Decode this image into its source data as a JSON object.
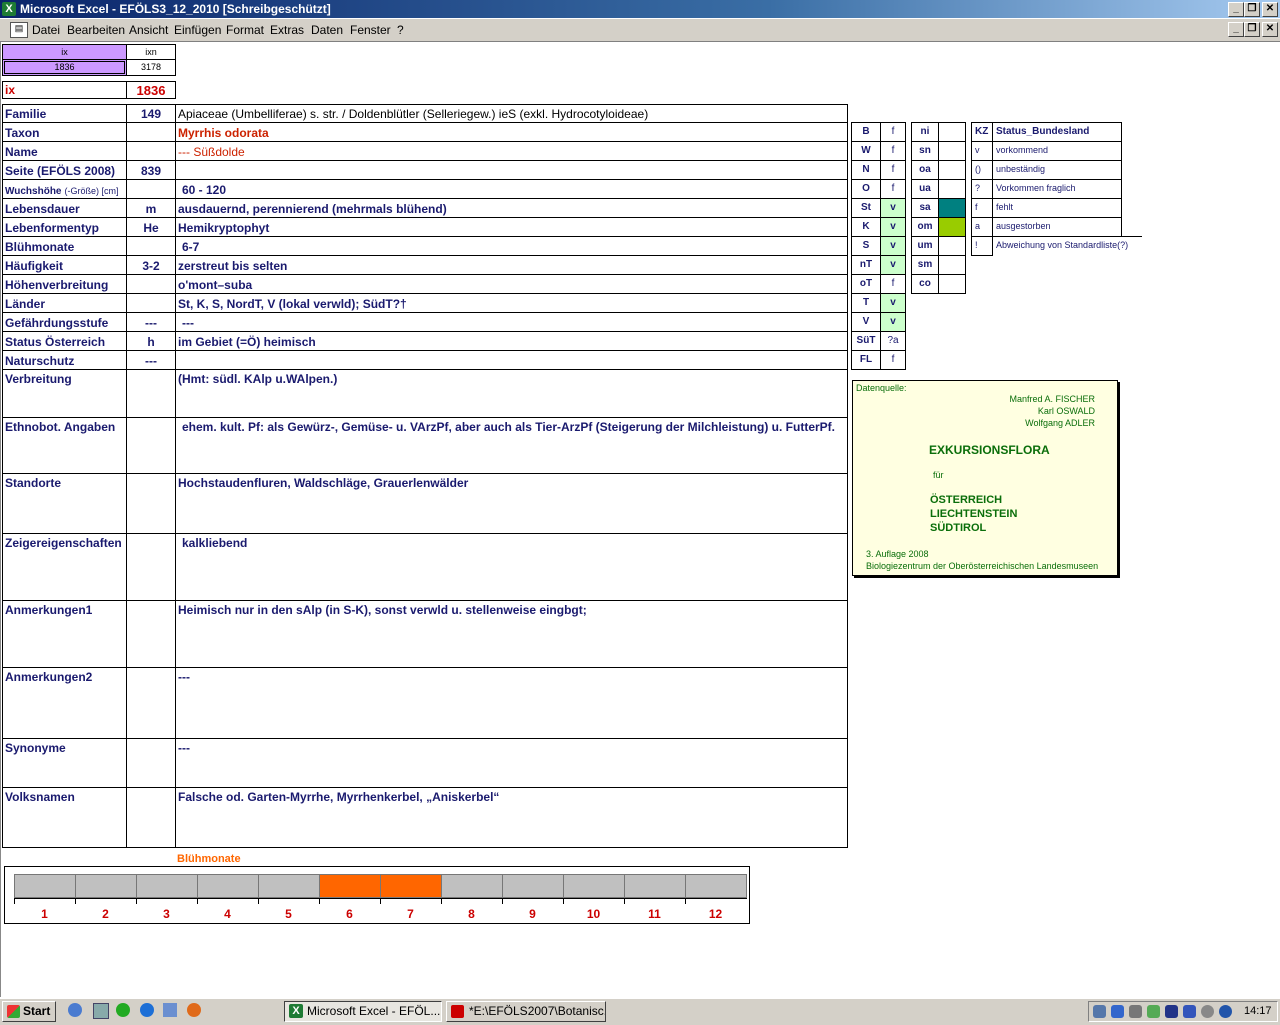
{
  "window": {
    "title": "Microsoft Excel - EFÖLS3_12_2010  [Schreibgeschützt]"
  },
  "menu": [
    "Datei",
    "Bearbeiten",
    "Ansicht",
    "Einfügen",
    "Format",
    "Extras",
    "Daten",
    "Fenster",
    "?"
  ],
  "top": {
    "ix_label": "ix",
    "ixn_label": "ixn",
    "ix_value": "1836",
    "ixn_value": "3178",
    "ix_big_label": "ix",
    "ix_big_value": "1836"
  },
  "rows": [
    {
      "label": "Familie",
      "code": "149",
      "value": "Apiaceae (Umbelliferae) s. str.  /  Doldenblütler (Selleriegew.) ieS (exkl. Hydrocotyloideae)"
    },
    {
      "label": "Taxon",
      "code": "",
      "value": "Myrrhis odorata"
    },
    {
      "label": "Name",
      "code": "",
      "value": "--- Süßdolde"
    },
    {
      "label": "Seite (EFÖLS 2008)",
      "code": "839",
      "value": ""
    },
    {
      "label": "Wuchshöhe",
      "label_suffix": "(-Größe) [cm]",
      "code": "",
      "value": "60 - 120"
    },
    {
      "label": "Lebensdauer",
      "code": "m",
      "value": "ausdauernd, perennierend (mehrmals blühend)"
    },
    {
      "label": "Lebenformentyp",
      "code": "He",
      "value": "Hemikryptophyt"
    },
    {
      "label": "Blühmonate",
      "code": "",
      "value": "6-7"
    },
    {
      "label": "Häufigkeit",
      "code": "3-2",
      "value": "zerstreut bis selten"
    },
    {
      "label": "Höhenverbreitung",
      "code": "",
      "value": "o'mont–suba"
    },
    {
      "label": "Länder",
      "code": "",
      "value": "St, K, S, NordT, V (lokal verwld); SüdT?†"
    },
    {
      "label": "Gefährdungsstufe",
      "code": "---",
      "value": "---"
    },
    {
      "label": "Status Österreich",
      "code": "h",
      "value": "im Gebiet (=Ö) heimisch"
    },
    {
      "label": "Naturschutz",
      "code": "---",
      "value": ""
    },
    {
      "label": "Verbreitung",
      "code": "",
      "value": "(Hmt: südl. KAlp u.WAlpen.)"
    },
    {
      "label": "Ethnobot. Angaben",
      "code": "",
      "value": "ehem. kult. Pf: als Gewürz-, Gemüse- u. VArzPf, aber auch als Tier-ArzPf (Steigerung der Milchleistung) u. FutterPf."
    },
    {
      "label": "Standorte",
      "code": "",
      "value": "Hochstaudenfluren, Waldschläge, Grauerlenwälder"
    },
    {
      "label": "Zeigereigenschaften",
      "code": "",
      "value": "kalkliebend"
    },
    {
      "label": "Anmerkungen1",
      "code": "",
      "value": "Heimisch nur in den sAlp (in S-K), sonst verwld u. stellenweise eingbgt;"
    },
    {
      "label": "Anmerkungen2",
      "code": "",
      "value": "---"
    },
    {
      "label": "Synonyme",
      "code": "",
      "value": "---"
    },
    {
      "label": "Volksnamen",
      "code": "",
      "value": "Falsche od. Garten-Myrrhe, Myrrhenkerbel, „Aniskerbel“"
    }
  ],
  "states": [
    {
      "k": "B",
      "v": "f"
    },
    {
      "k": "W",
      "v": "f"
    },
    {
      "k": "N",
      "v": "f"
    },
    {
      "k": "O",
      "v": "f"
    },
    {
      "k": "St",
      "v": "v"
    },
    {
      "k": "K",
      "v": "v"
    },
    {
      "k": "S",
      "v": "v"
    },
    {
      "k": "nT",
      "v": "v"
    },
    {
      "k": "oT",
      "v": "f"
    },
    {
      "k": "T",
      "v": "v"
    },
    {
      "k": "V",
      "v": "v"
    },
    {
      "k": "SüT",
      "v": "?a"
    },
    {
      "k": "FL",
      "v": "f"
    }
  ],
  "zones": [
    {
      "k": "ni",
      "v": ""
    },
    {
      "k": "sn",
      "v": ""
    },
    {
      "k": "oa",
      "v": ""
    },
    {
      "k": "ua",
      "v": ""
    },
    {
      "k": "sa",
      "v": "",
      "color": "#008080"
    },
    {
      "k": "om",
      "v": "",
      "color": "#99cc00"
    },
    {
      "k": "um",
      "v": ""
    },
    {
      "k": "sm",
      "v": ""
    },
    {
      "k": "co",
      "v": ""
    }
  ],
  "legend": {
    "head_k": "KZ",
    "head_v": "Status_Bundesland",
    "items": [
      {
        "k": "v",
        "v": "vorkommend"
      },
      {
        "k": "()",
        "v": "unbeständig"
      },
      {
        "k": "?",
        "v": "Vorkommen fraglich"
      },
      {
        "k": "f",
        "v": "fehlt"
      },
      {
        "k": "a",
        "v": "ausgestorben"
      },
      {
        "k": "!",
        "v": "Abweichung von Standardliste(?)"
      }
    ]
  },
  "source": {
    "label": "Datenquelle:",
    "authors": [
      "Manfred A. FISCHER",
      "Karl OSWALD",
      "Wolfgang ADLER"
    ],
    "title": "EXKURSIONSFLORA",
    "fuer": "für",
    "countries": [
      "ÖSTERREICH",
      "LIECHTENSTEIN",
      "SÜDTIROL"
    ],
    "edition": "3. Auflage 2008",
    "publisher": "Biologiezentrum der Oberösterreichischen Landesmuseen"
  },
  "bloom": {
    "title": "Blühmonate",
    "months": [
      "1",
      "2",
      "3",
      "4",
      "5",
      "6",
      "7",
      "8",
      "9",
      "10",
      "11",
      "12"
    ],
    "active": [
      6,
      7
    ],
    "active_color": "#ff6600",
    "inactive_color": "#c0c0c0"
  },
  "taskbar": {
    "start": "Start",
    "tasks": [
      "Microsoft Excel - EFÖL...",
      "*E:\\EFÖLS2007\\Botanisc..."
    ],
    "clock": "14:17"
  }
}
